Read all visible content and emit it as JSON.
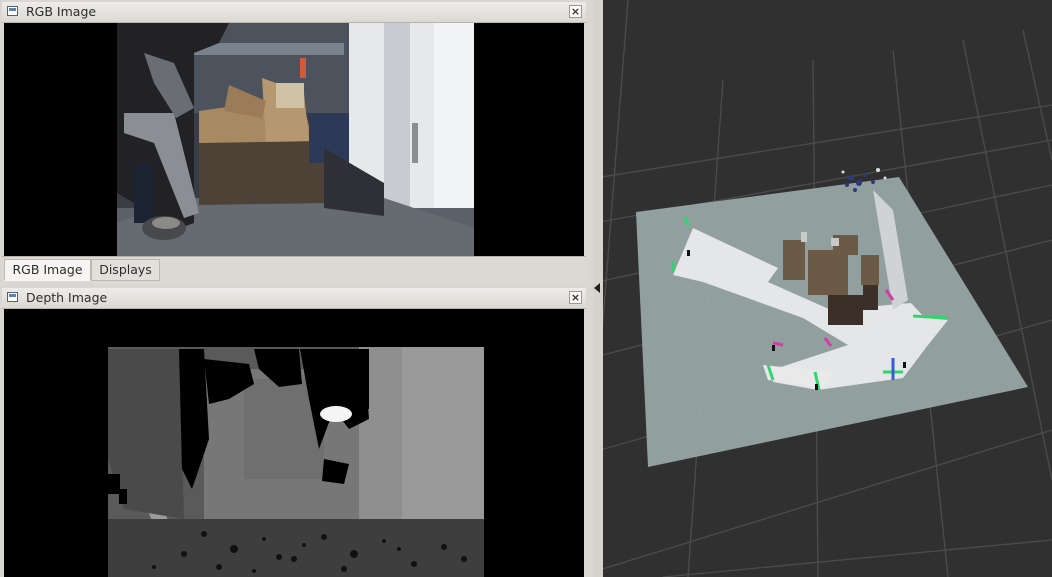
{
  "rgb_panel": {
    "title": "RGB Image",
    "close": "×"
  },
  "tabs": [
    {
      "label": "RGB Image"
    },
    {
      "label": "Displays"
    }
  ],
  "depth_panel": {
    "title": "Depth Image",
    "close": "×"
  }
}
